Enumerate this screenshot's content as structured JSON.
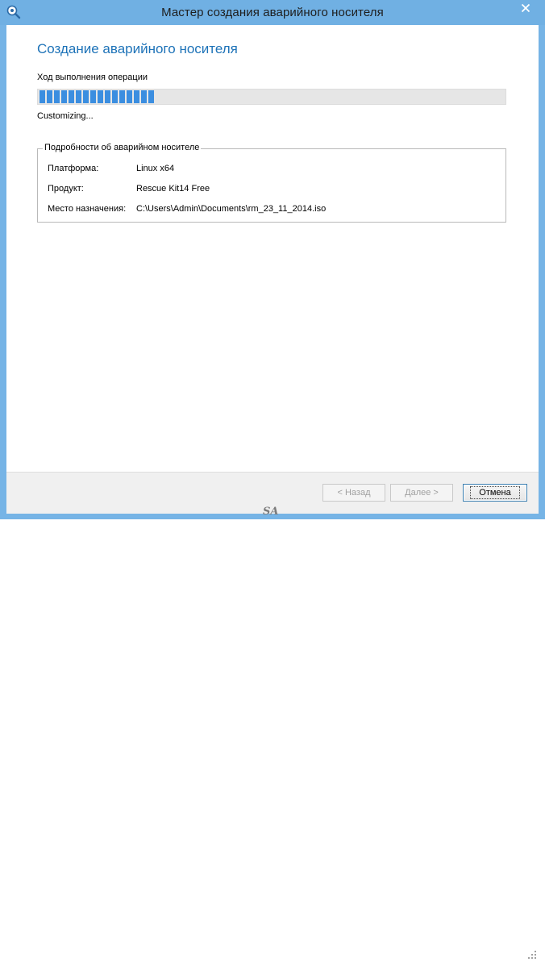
{
  "window": {
    "title": "Мастер создания аварийного носителя",
    "app_icon": "disk-search-icon",
    "close_icon": "close-icon",
    "close_color": "#d9452c"
  },
  "page": {
    "heading": "Создание аварийного носителя",
    "progress_label": "Ход выполнения операции",
    "progress_fraction": 0.25,
    "status": "Customizing..."
  },
  "details": {
    "legend": "Подробности об аварийном носителе",
    "rows": [
      {
        "key": "Платформа:",
        "value": "Linux x64"
      },
      {
        "key": "Продукт:",
        "value": "Rescue Kit14 Free"
      },
      {
        "key": "Место назначения:",
        "value": "C:\\Users\\Admin\\Documents\\rm_23_11_2014.iso"
      }
    ]
  },
  "buttons": {
    "back": "< Назад",
    "next": "Далее >",
    "cancel": "Отмена"
  },
  "watermark": "SA",
  "colors": {
    "titlebar": "#70b0e3",
    "heading": "#1e73b8",
    "progress": "#3b8ee0"
  }
}
